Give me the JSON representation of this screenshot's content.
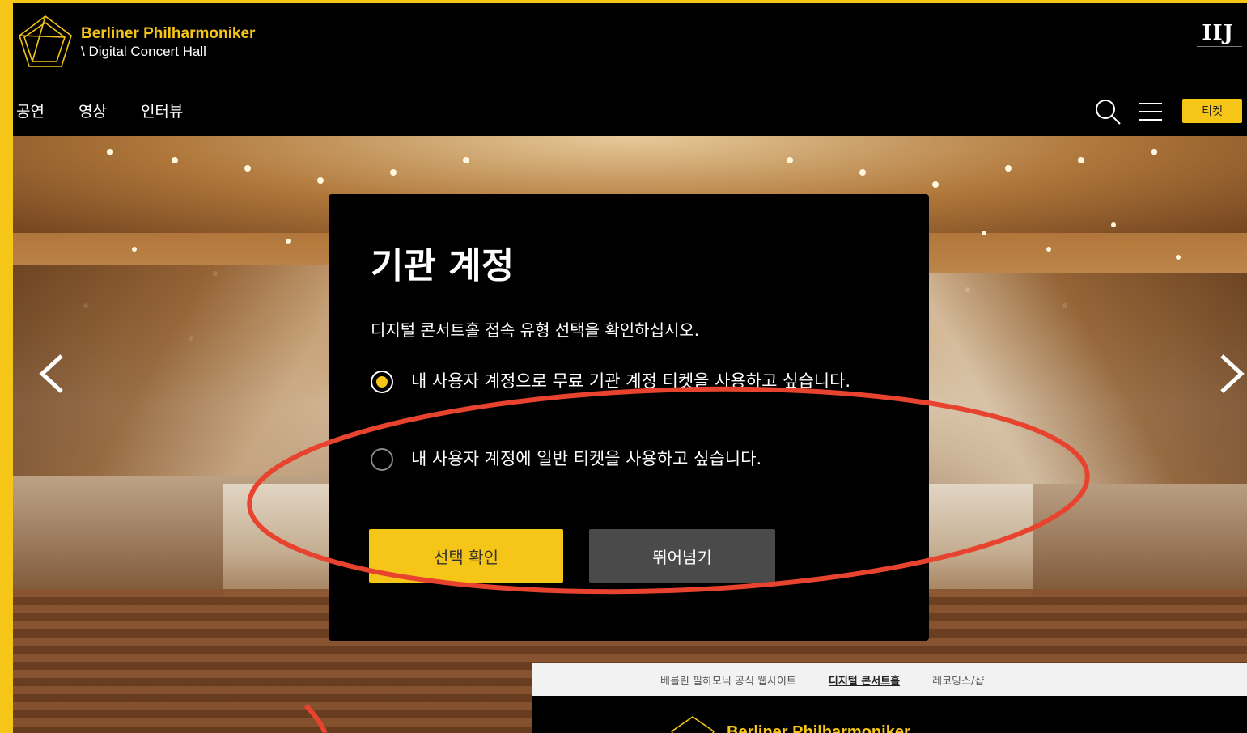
{
  "header": {
    "brand_line1": "Berliner Philharmoniker",
    "brand_line2": "\\ Digital Concert Hall",
    "partner_logo": "IIJ",
    "nav": [
      "공연",
      "영상",
      "인터뷰"
    ],
    "ticket_label": "티켓",
    "icons": [
      "pentagon-logo-icon",
      "search-icon",
      "menu-icon"
    ]
  },
  "hero": {
    "icons": [
      "chevron-left-icon",
      "chevron-right-icon"
    ]
  },
  "modal": {
    "title": "기관 계정",
    "description": "디지털 콘서트홀 접속 유형 선택을 확인하십시오.",
    "options": [
      {
        "label": "내 사용자 계정으로 무료 기관 계정 티켓을 사용하고 싶습니다.",
        "selected": true
      },
      {
        "label": "내 사용자 계정에 일반 티켓을 사용하고 싶습니다.",
        "selected": false
      }
    ],
    "confirm_label": "선택 확인",
    "skip_label": "뛰어넘기"
  },
  "inset": {
    "top_links": [
      "베를린 필하모닉 공식 웹사이트",
      "디지털 콘서트홀",
      "레코딩스/샵"
    ],
    "active_link": "디지털 콘서트홀",
    "brand": "Berliner Philharmoniker"
  },
  "colors": {
    "accent": "#f5c518",
    "background": "#000000",
    "annotation": "#e8432e",
    "skip_button": "#4a4a4a"
  }
}
